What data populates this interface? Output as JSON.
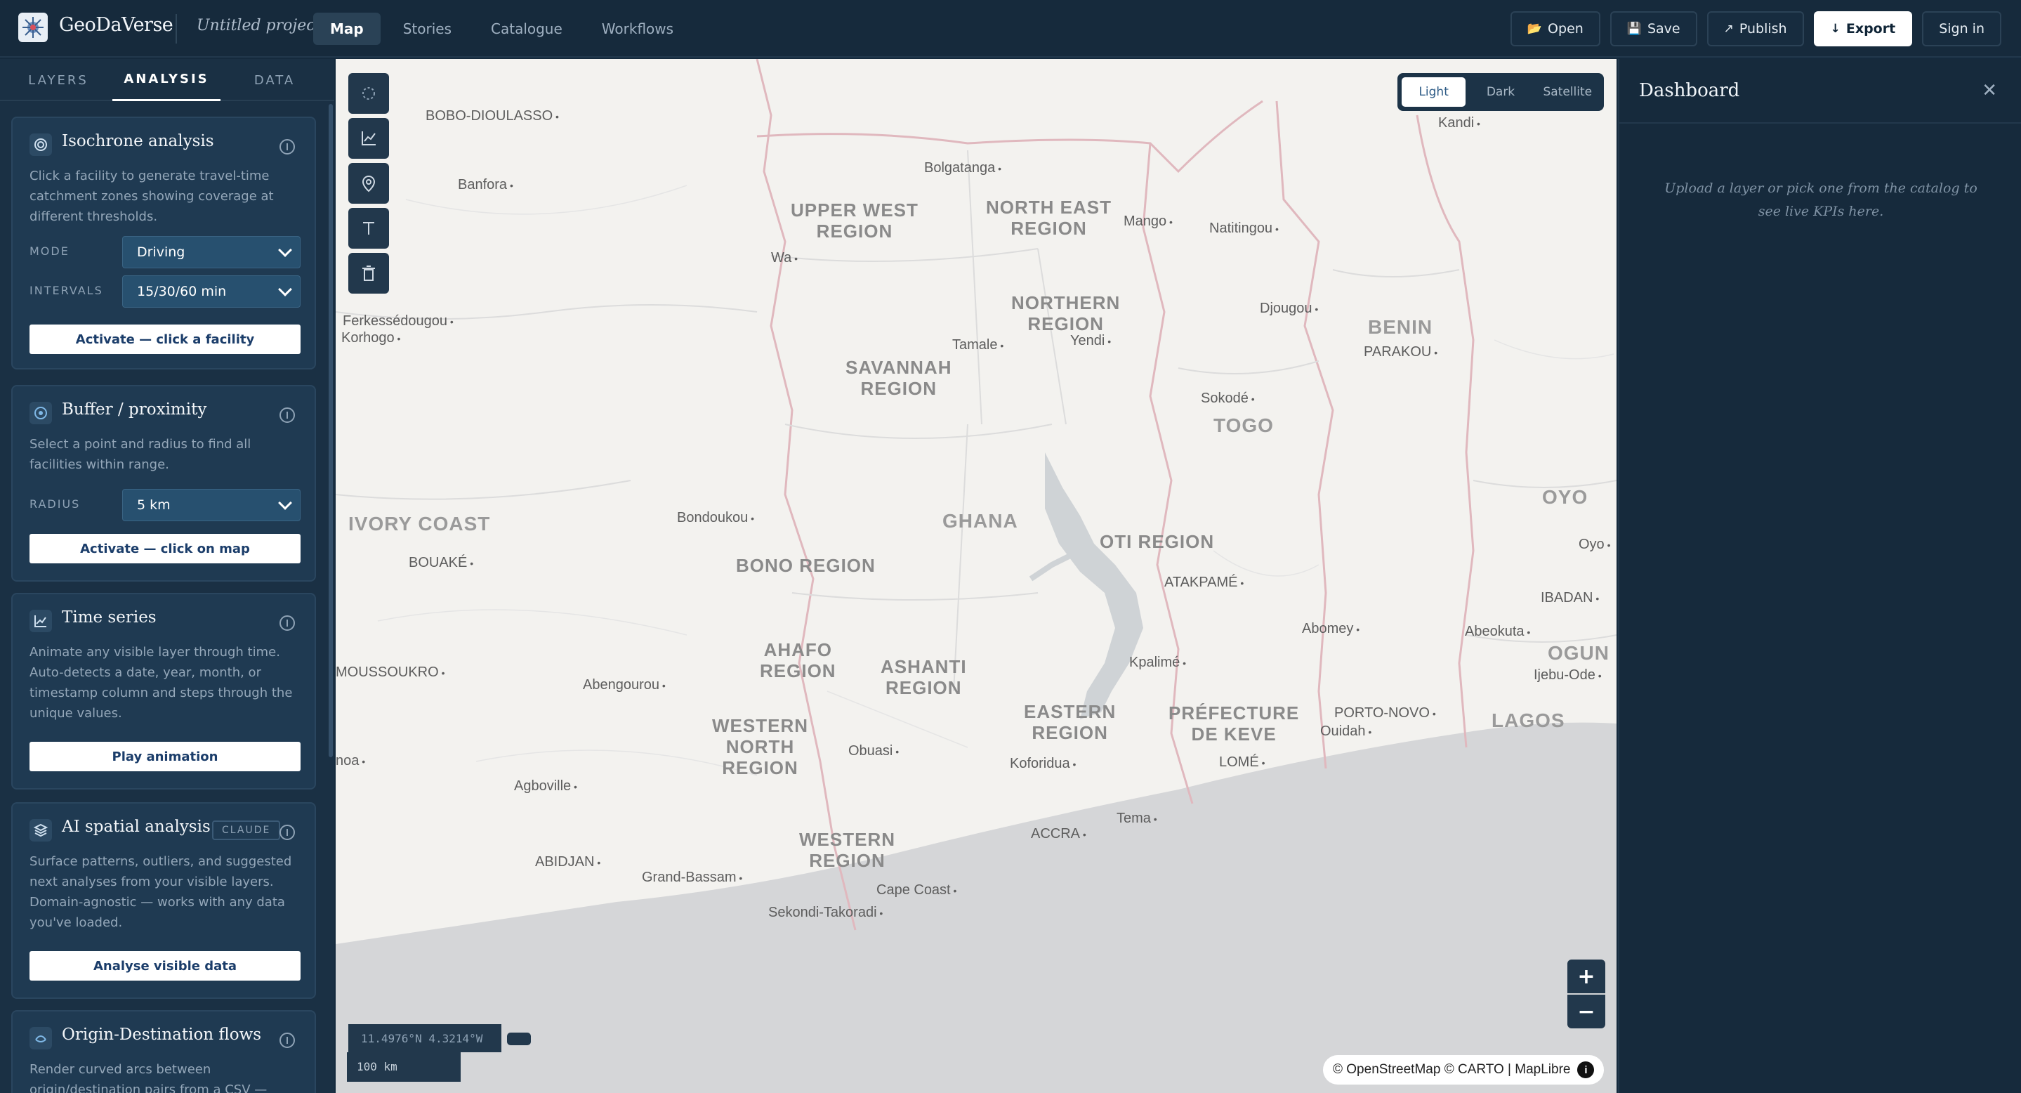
{
  "app": {
    "name": "GeoDaVerse",
    "project": "Untitled project"
  },
  "nav": {
    "items": [
      "Map",
      "Stories",
      "Catalogue",
      "Workflows"
    ],
    "active": "Map"
  },
  "actions": {
    "open": "Open",
    "save": "Save",
    "publish": "Publish",
    "export": "Export",
    "signin": "Sign in"
  },
  "left": {
    "tabs": [
      "LAYERS",
      "ANALYSIS",
      "DATA"
    ],
    "active_tab": "ANALYSIS",
    "cards": {
      "isochrone": {
        "title": "Isochrone analysis",
        "desc": "Click a facility to generate travel-time catchment zones showing coverage at different thresholds.",
        "mode_label": "MODE",
        "mode_value": "Driving",
        "intervals_label": "INTERVALS",
        "intervals_value": "15/30/60 min",
        "button": "Activate — click a facility"
      },
      "buffer": {
        "title": "Buffer / proximity",
        "desc": "Select a point and radius to find all facilities within range.",
        "radius_label": "RADIUS",
        "radius_value": "5 km",
        "button": "Activate — click on map"
      },
      "timeseries": {
        "title": "Time series",
        "desc": "Animate any visible layer through time. Auto-detects a date, year, month, or timestamp column and steps through the unique values.",
        "button": "Play animation"
      },
      "ai": {
        "title": "AI spatial analysis",
        "badge": "CLAUDE",
        "desc": "Surface patterns, outliers, and suggested next analyses from your visible layers. Domain-agnostic — works with any data you've loaded.",
        "button": "Analyse visible data"
      },
      "od": {
        "title": "Origin-Destination flows",
        "desc": "Render curved arcs between origin/destination pairs from a CSV — width"
      }
    }
  },
  "map": {
    "basemaps": [
      "Light",
      "Dark",
      "Satellite"
    ],
    "active_basemap": "Light",
    "coords": "11.4976°N 4.3214°W",
    "scale": "100 km",
    "attribution": "© OpenStreetMap © CARTO | MapLibre",
    "labels": {
      "bobo": "BOBO-DIOULASSO",
      "kandi": "Kandi",
      "bolgatanga": "Bolgatanga",
      "banfora": "Banfora",
      "upperwest": "UPPER WEST\nREGION",
      "northeast": "NORTH EAST\nREGION",
      "mango": "Mango",
      "natitingou": "Natitingou",
      "wa": "Wa",
      "ferke": "Ferkessédougou",
      "korhogo": "Korhogo",
      "northern": "NORTHERN\nREGION",
      "djougou": "Djougou",
      "benin": "BENIN",
      "parakou": "PARAKOU",
      "tamale": "Tamale",
      "yendi": "Yendi",
      "savannah": "SAVANNAH\nREGION",
      "sokode": "Sokodé",
      "togo": "TOGO",
      "oyo": "OYO",
      "ivory": "IVORY COAST",
      "bondoukou": "Bondoukou",
      "ghana": "GHANA",
      "bouake": "BOUAKÉ",
      "bono": "BONO REGION",
      "oti": "OTI REGION",
      "atakpame": "ATAKPAMÉ",
      "oyo2": "Oyo",
      "ibadan": "IBADAN",
      "abomey": "Abomey",
      "abeokuta": "Abeokuta",
      "ahafo": "AHAFO\nREGION",
      "ashanti": "ASHANTI\nREGION",
      "ogun": "OGUN",
      "moussoukro": "MOUSSOUKRO",
      "abengourou": "Abengourou",
      "kpalime": "Kpalimé",
      "ijebu": "Ijebu-Ode",
      "eastern": "EASTERN\nREGION",
      "prefecture": "PRÉFECTURE\nDE KEVE",
      "portonovo": "PORTO-NOVO",
      "ouidah": "Ouidah",
      "lagos": "LAGOS",
      "westernnorth": "WESTERN\nNORTH\nREGION",
      "obuasi": "Obuasi",
      "noa": "noa",
      "koforidua": "Koforidua",
      "lome": "LOMÉ",
      "agboville": "Agboville",
      "tema": "Tema",
      "accra": "ACCRA",
      "abidjan": "ABIDJAN",
      "western": "WESTERN\nREGION",
      "grandbassam": "Grand-Bassam",
      "capecoast": "Cape Coast",
      "sekondi": "Sekondi-Takoradi"
    }
  },
  "dashboard": {
    "title": "Dashboard",
    "empty": "Upload a layer or pick one from the catalog to see live KPIs here."
  },
  "colors": {
    "bg": "#162a3c",
    "panel": "#1a3044",
    "card": "#1f3a52",
    "select": "#27506f",
    "map_land": "#f3f2ef",
    "map_sea": "#d5d6d8",
    "button_text": "#1b3d6a"
  }
}
